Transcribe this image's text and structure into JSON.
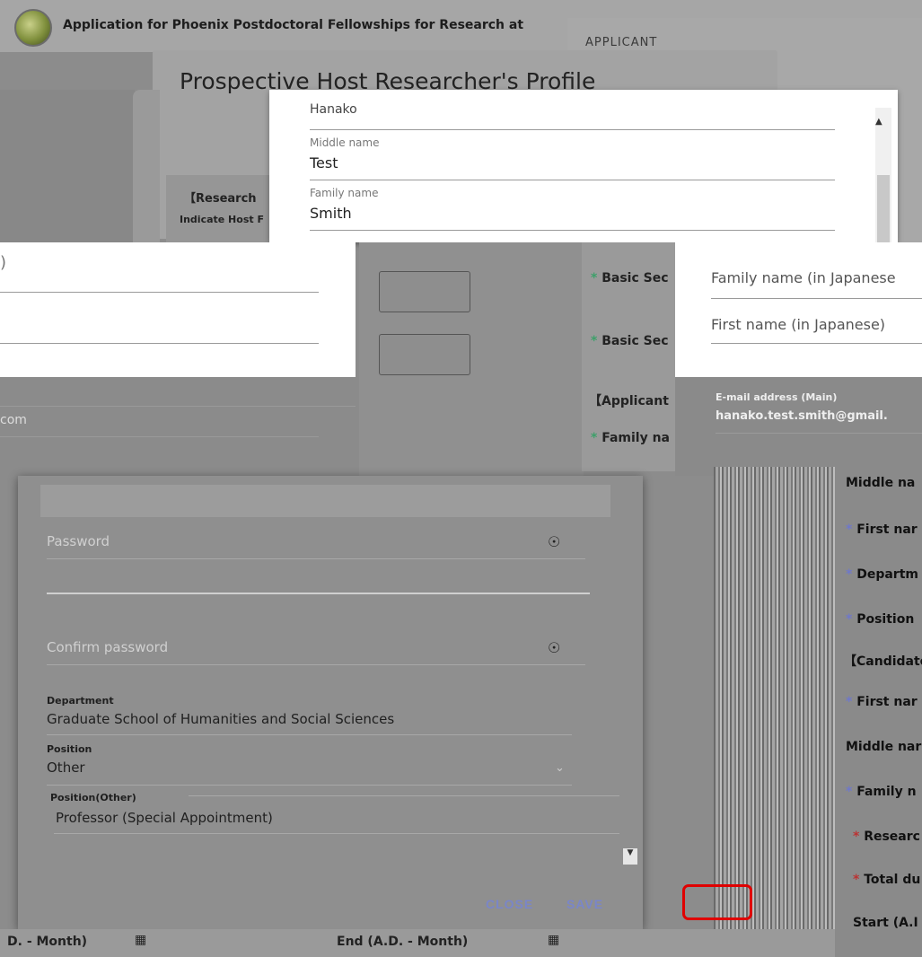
{
  "header": {
    "app_title": "Application for Phoenix Postdoctoral Fellowships for Research at"
  },
  "applicant_panel": {
    "label": "APPLICANT"
  },
  "profile": {
    "title": "Prospective Host Researcher's Profile"
  },
  "research": {
    "heading": "【Research",
    "sub": "Indicate Host F"
  },
  "names_card": {
    "given_name_value": "Hanako",
    "middle_label": "Middle name",
    "middle_value": "Test",
    "family_label": "Family name",
    "family_value": "Smith"
  },
  "basic_sections": {
    "items": [
      "Basic Sec",
      "Basic Sec"
    ],
    "applicant_heading": "【Applicant",
    "family_name_item": "Family na"
  },
  "jp_form": {
    "family_jp_placeholder": "Family name (in Japanese",
    "first_jp_placeholder": "First name (in Japanese)"
  },
  "right_data": {
    "email_label": "E-mail address (Main)",
    "email_value": "hanako.test.smith@gmail."
  },
  "dialog": {
    "password_label": "Password",
    "confirm_label": "Confirm password",
    "department_label": "Department",
    "department_value": "Graduate School of Humanities and Social Sciences",
    "position_label": "Position",
    "position_value": "Other",
    "position_other_label": "Position(Other)",
    "position_other_value": "Professor (Special Appointment)",
    "close_button": "CLOSE",
    "save_button": "SAVE"
  },
  "right_lower": {
    "items": [
      {
        "star": "",
        "text": "Middle na"
      },
      {
        "star": "*",
        "text": "First nar"
      },
      {
        "star": "*",
        "text": "Departm"
      },
      {
        "star": "*",
        "text": "Position"
      },
      {
        "star": "",
        "text": "【Candidate"
      },
      {
        "star": "*",
        "text": "First nar"
      },
      {
        "star": "",
        "text": "Middle nar"
      },
      {
        "star": "*",
        "text": "Family n"
      },
      {
        "star": "*",
        "text": "Researc"
      },
      {
        "star": "*",
        "text": "Total du"
      },
      {
        "star": "",
        "text": "Start (A.I"
      }
    ]
  },
  "bottom": {
    "left_text": "D. - Month)",
    "mid_text": "End (A.D. - Month)"
  },
  "colors": {
    "highlight": "#e00000",
    "required_star": "#3da06a",
    "button_text": "#7a86c8"
  }
}
